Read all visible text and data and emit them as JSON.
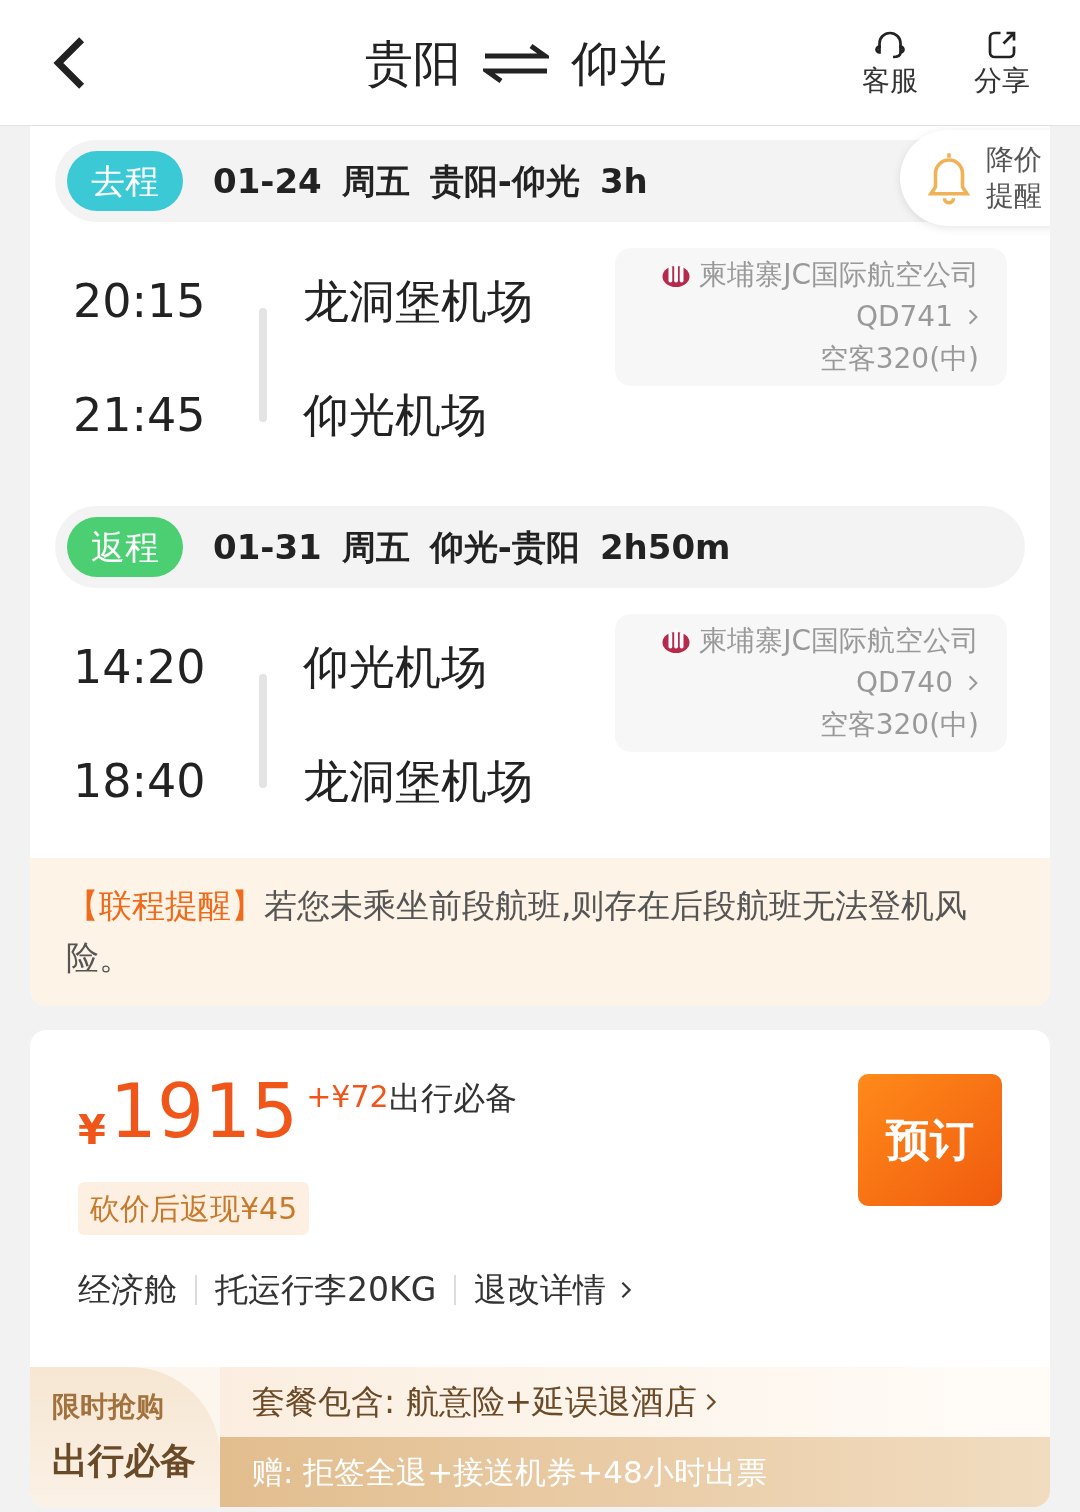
{
  "header": {
    "from": "贵阳",
    "to": "仰光",
    "actions": [
      {
        "kind": "support",
        "label": "客服"
      },
      {
        "kind": "share",
        "label": "分享"
      }
    ]
  },
  "price_alert": {
    "lines": [
      "降价",
      "提醒"
    ]
  },
  "legs": [
    {
      "kind": "outbound",
      "tag": "去程",
      "summary": [
        "01-24",
        "周五",
        "贵阳-仰光",
        "3h"
      ],
      "depart_time": "20:15",
      "depart_airport": "龙洞堡机场",
      "arrive_time": "21:45",
      "arrive_airport": "仰光机场",
      "airline": "柬埔寨JC国际航空公司",
      "flight_no": "QD741",
      "aircraft": "空客320(中)"
    },
    {
      "kind": "return",
      "tag": "返程",
      "summary": [
        "01-31",
        "周五",
        "仰光-贵阳",
        "2h50m"
      ],
      "depart_time": "14:20",
      "depart_airport": "仰光机场",
      "arrive_time": "18:40",
      "arrive_airport": "龙洞堡机场",
      "airline": "柬埔寨JC国际航空公司",
      "flight_no": "QD740",
      "aircraft": "空客320(中)"
    }
  ],
  "notice": {
    "label": "【联程提醒】",
    "text": "若您未乘坐前段航班,则存在后段航班无法登机风险。"
  },
  "offer": {
    "currency": "¥",
    "price": "1915",
    "extra": "+¥72",
    "extra_label": "出行必备",
    "cashback": "砍价后返现¥45",
    "button": "预订",
    "features": [
      {
        "kind": "plain",
        "label": "经济舱"
      },
      {
        "kind": "plain",
        "label": "托运行李20KG"
      },
      {
        "kind": "link",
        "label": "退改详情"
      }
    ]
  },
  "bundle": {
    "badge": [
      "限时抢购",
      "出行必备"
    ],
    "includes": "套餐包含: 航意险+延误退酒店",
    "gift": "赠: 拒签全退+接送机券+48小时出票"
  }
}
